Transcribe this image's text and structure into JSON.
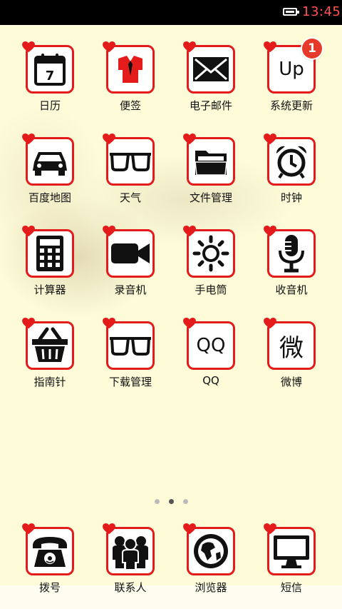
{
  "status_bar": {
    "time": "13:45"
  },
  "apps": [
    {
      "label": "日历",
      "icon": "calendar-icon",
      "day": "7"
    },
    {
      "label": "便签",
      "icon": "shirt-icon"
    },
    {
      "label": "电子邮件",
      "icon": "envelope-icon"
    },
    {
      "label": "系统更新",
      "icon": "update-icon",
      "text": "Up",
      "badge": "1"
    },
    {
      "label": "百度地图",
      "icon": "car-icon"
    },
    {
      "label": "天气",
      "icon": "glasses-icon"
    },
    {
      "label": "文件管理",
      "icon": "folder-icon"
    },
    {
      "label": "时钟",
      "icon": "alarm-clock-icon"
    },
    {
      "label": "计算器",
      "icon": "calculator-icon"
    },
    {
      "label": "录音机",
      "icon": "video-camera-icon"
    },
    {
      "label": "手电筒",
      "icon": "sun-icon"
    },
    {
      "label": "收音机",
      "icon": "microphone-icon"
    },
    {
      "label": "指南针",
      "icon": "basket-icon"
    },
    {
      "label": "下载管理",
      "icon": "glasses-icon"
    },
    {
      "label": "QQ",
      "icon": "qq-text-icon",
      "text": "QQ"
    },
    {
      "label": "微博",
      "icon": "weibo-text-icon",
      "text": "微"
    }
  ],
  "page_indicator": {
    "count": 3,
    "active": 2
  },
  "dock": [
    {
      "label": "拨号",
      "icon": "telephone-icon"
    },
    {
      "label": "联系人",
      "icon": "contacts-icon"
    },
    {
      "label": "浏览器",
      "icon": "globe-icon"
    },
    {
      "label": "短信",
      "icon": "monitor-icon"
    }
  ],
  "colors": {
    "accent": "#e31b1b",
    "background": "#fdfbd8",
    "badge": "#e53a2a"
  }
}
